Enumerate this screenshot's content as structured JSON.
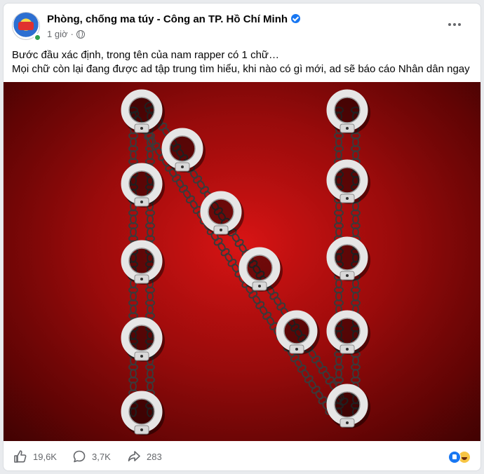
{
  "post": {
    "page_name": "Phòng, chống ma túy - Công an TP. Hồ Chí Minh",
    "time": "1 giờ",
    "separator": "·",
    "text_line1": "Bước đầu xác định, trong tên của nam rapper có 1 chữ…",
    "text_line2": "Mọi chữ còn lại đang được ad tập trung tìm hiểu, khi nào có gì mới, ad sẽ báo cáo Nhân dân ngay"
  },
  "image": {
    "subject": "letter N made of handcuffs and chains on red background",
    "background_color": "#c20f0f",
    "cuff_color": "#e6e6e6"
  },
  "stats": {
    "likes": "19,6K",
    "comments": "3,7K",
    "shares": "283"
  },
  "icons": {
    "like": "like-icon",
    "comment": "comment-icon",
    "share": "share-icon",
    "more": "more-icon",
    "globe": "globe-icon",
    "verified": "verified-icon"
  },
  "colors": {
    "accent": "#1877f2",
    "secondary_text": "#65676b"
  }
}
